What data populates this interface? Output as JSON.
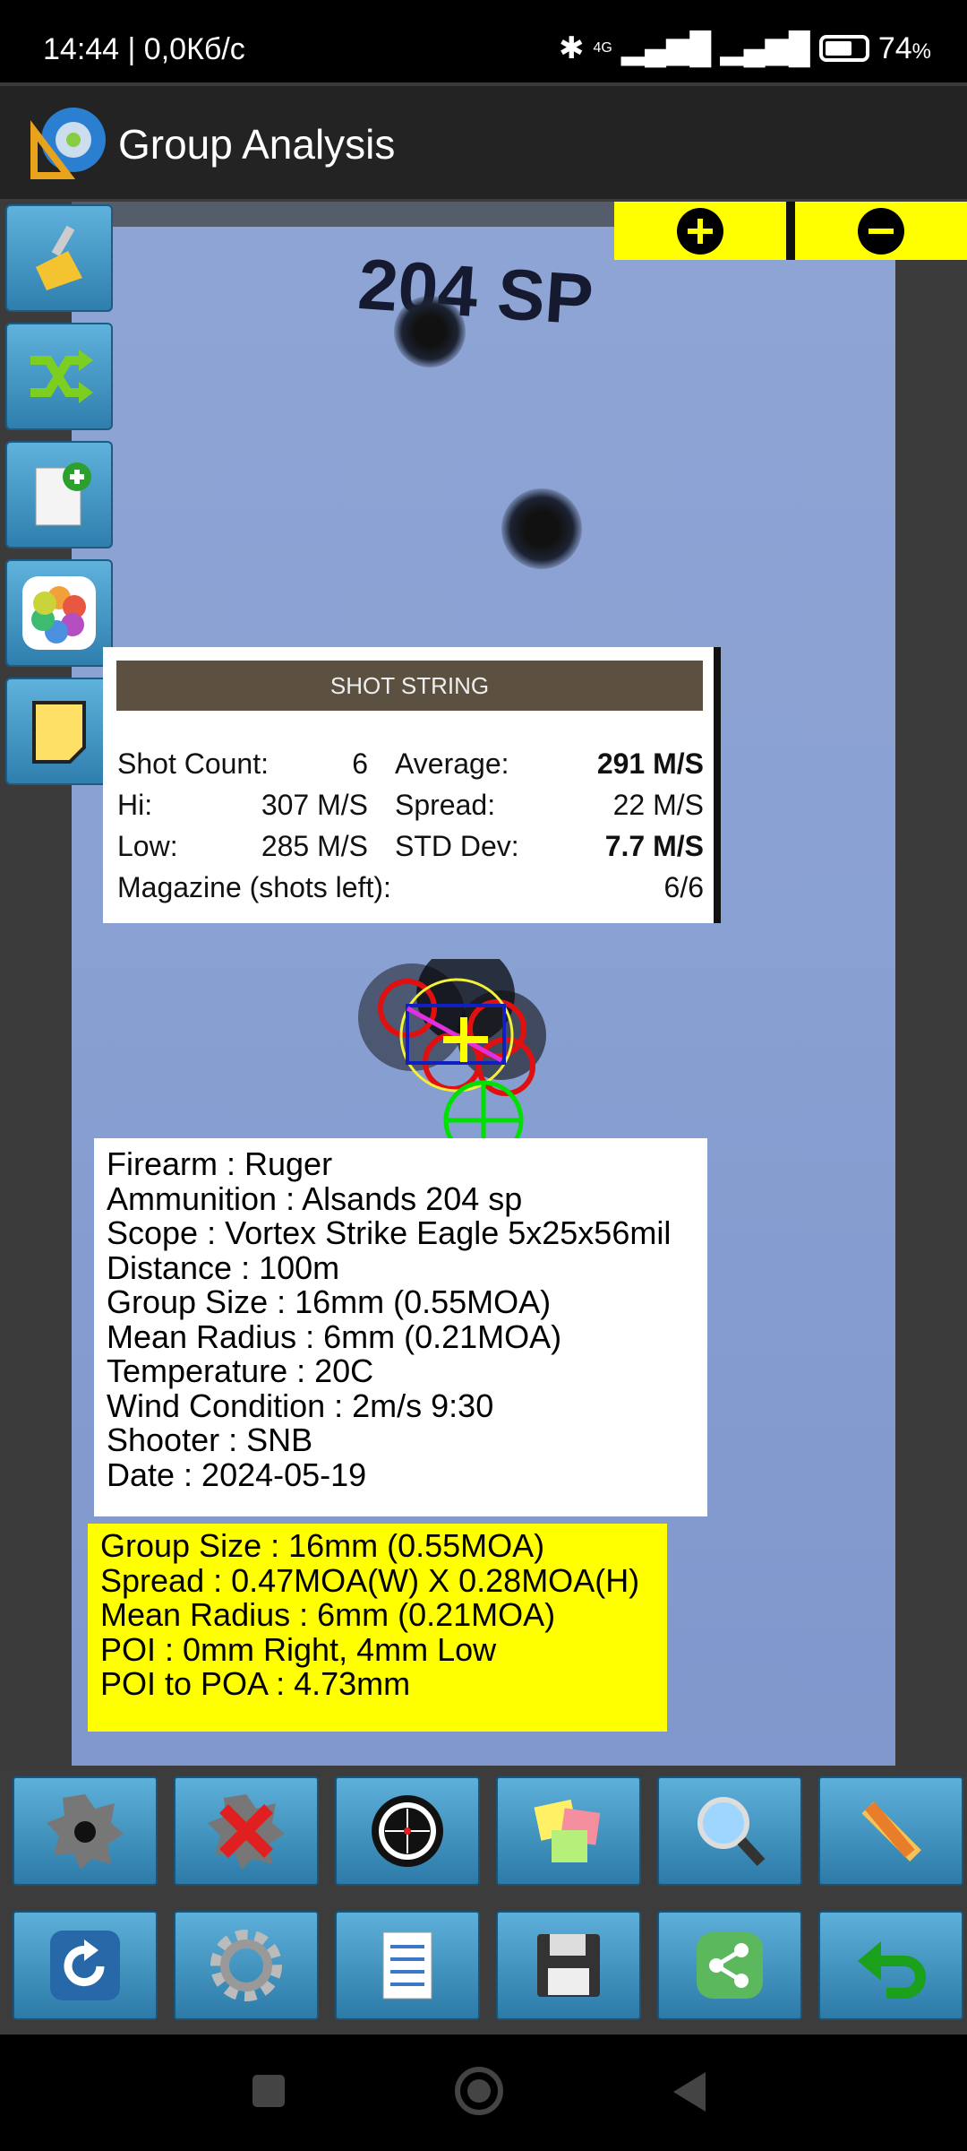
{
  "status": {
    "time": "14:44 | 0,0Кб/с",
    "network": "4G",
    "battery": "74",
    "battery_unit": "%"
  },
  "app": {
    "title": "Group Analysis"
  },
  "target": {
    "label": "204 SP"
  },
  "shot_string": {
    "title": "SHOT STRING",
    "shot_count_label": "Shot Count:",
    "shot_count": "6",
    "average_label": "Average:",
    "average": "291 M/S",
    "hi_label": "Hi:",
    "hi": "307 M/S",
    "spread_label": "Spread:",
    "spread": "22 M/S",
    "low_label": "Low:",
    "low": "285 M/S",
    "std_label": "STD Dev:",
    "std": "7.7 M/S",
    "magazine_label": "Magazine (shots left):",
    "magazine": "6/6"
  },
  "info": [
    "Firearm : Ruger",
    "Ammunition : Alsands 204 sp",
    "Scope : Vortex Strike Eagle 5x25x56mil",
    "Distance : 100m",
    "Group Size : 16mm (0.55MOA)",
    "Mean Radius : 6mm (0.21MOA)",
    "Temperature : 20C",
    "Wind Condition : 2m/s 9:30",
    "Shooter : SNB",
    "Date : 2024-05-19"
  ],
  "summary": [
    "Group Size : 16mm (0.55MOA)",
    "Spread : 0.47MOA(W) X 0.28MOA(H)",
    "Mean Radius : 6mm (0.21MOA)",
    "POI : 0mm Right,  4mm Low",
    "POI to POA : 4.73mm"
  ],
  "colors": {
    "accent": "#ffff00",
    "header": "#5c5140",
    "button": "#3f93c4"
  }
}
